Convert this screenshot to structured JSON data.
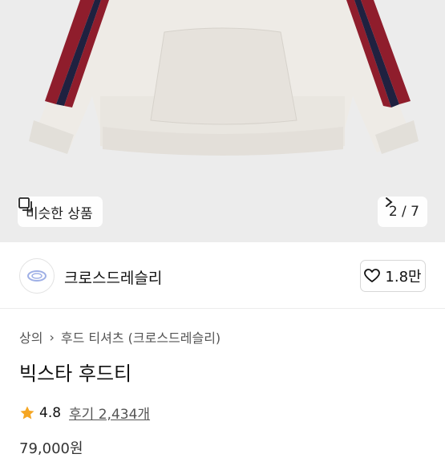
{
  "hero": {
    "similar_label": "비슷한 상품",
    "page_indicator": "2 / 7",
    "similar_icon": "copy-icon",
    "next_icon": "chevron-right-icon"
  },
  "shop": {
    "name": "크로스드레슬리",
    "like_count": "1.8만",
    "like_icon": "heart-outline-icon"
  },
  "product": {
    "breadcrumb": [
      "상의",
      "후드 티셔츠 (크로스드레슬리)"
    ],
    "title": "빅스타 후드티",
    "rating": "4.8",
    "reviews": "후기 2,434개",
    "price_partial": "79,000원"
  },
  "colors": {
    "star": "#f5a623",
    "stripe_red": "#8f1d2c",
    "stripe_navy": "#1f2140",
    "fabric": "#eeebe6"
  }
}
